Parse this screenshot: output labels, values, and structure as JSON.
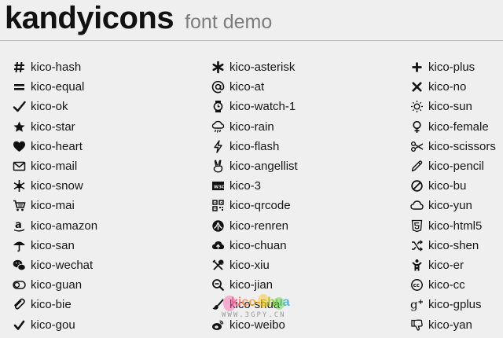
{
  "header": {
    "title": "kandyicons",
    "subtitle": "font demo"
  },
  "columns": [
    [
      {
        "label": "kico-hash",
        "icon": "hash-icon"
      },
      {
        "label": "kico-equal",
        "icon": "equal-icon"
      },
      {
        "label": "kico-ok",
        "icon": "check-icon"
      },
      {
        "label": "kico-star",
        "icon": "star-icon"
      },
      {
        "label": "kico-heart",
        "icon": "heart-icon"
      },
      {
        "label": "kico-mail",
        "icon": "mail-icon"
      },
      {
        "label": "kico-snow",
        "icon": "snowflake-icon"
      },
      {
        "label": "kico-mai",
        "icon": "shopping-cart-icon"
      },
      {
        "label": "kico-amazon",
        "icon": "amazon-icon"
      },
      {
        "label": "kico-san",
        "icon": "umbrella-icon"
      },
      {
        "label": "kico-wechat",
        "icon": "wechat-icon"
      },
      {
        "label": "kico-guan",
        "icon": "toggle-icon"
      },
      {
        "label": "kico-bie",
        "icon": "paperclip-icon"
      },
      {
        "label": "kico-gou",
        "icon": "small-check-icon"
      }
    ],
    [
      {
        "label": "kico-asterisk",
        "icon": "asterisk-icon"
      },
      {
        "label": "kico-at",
        "icon": "at-icon"
      },
      {
        "label": "kico-watch-1",
        "icon": "watch-icon"
      },
      {
        "label": "kico-rain",
        "icon": "rain-cloud-icon"
      },
      {
        "label": "kico-flash",
        "icon": "flash-icon"
      },
      {
        "label": "kico-angellist",
        "icon": "angellist-icon"
      },
      {
        "label": "kico-3",
        "icon": "w3c-icon"
      },
      {
        "label": "kico-qrcode",
        "icon": "qrcode-icon"
      },
      {
        "label": "kico-renren",
        "icon": "renren-icon"
      },
      {
        "label": "kico-chuan",
        "icon": "cloud-upload-icon"
      },
      {
        "label": "kico-xiu",
        "icon": "tools-icon"
      },
      {
        "label": "kico-jian",
        "icon": "zoom-out-icon"
      },
      {
        "label": "kico-shua",
        "icon": "brush-icon"
      },
      {
        "label": "kico-weibo",
        "icon": "weibo-icon"
      }
    ],
    [
      {
        "label": "kico-plus",
        "icon": "plus-icon"
      },
      {
        "label": "kico-no",
        "icon": "close-icon"
      },
      {
        "label": "kico-sun",
        "icon": "sun-icon"
      },
      {
        "label": "kico-female",
        "icon": "female-icon"
      },
      {
        "label": "kico-scissors",
        "icon": "scissors-icon"
      },
      {
        "label": "kico-pencil",
        "icon": "pencil-icon"
      },
      {
        "label": "kico-bu",
        "icon": "ban-icon"
      },
      {
        "label": "kico-yun",
        "icon": "cloud-icon"
      },
      {
        "label": "kico-html5",
        "icon": "html5-icon"
      },
      {
        "label": "kico-shen",
        "icon": "shuffle-icon"
      },
      {
        "label": "kico-er",
        "icon": "child-icon"
      },
      {
        "label": "kico-cc",
        "icon": "creative-commons-icon"
      },
      {
        "label": "kico-gplus",
        "icon": "google-plus-icon"
      },
      {
        "label": "kico-yan",
        "icon": "thumbs-down-icon"
      }
    ]
  ],
  "watermark": {
    "text": "kico-shua",
    "url": "WWW.3GPY.CN"
  }
}
